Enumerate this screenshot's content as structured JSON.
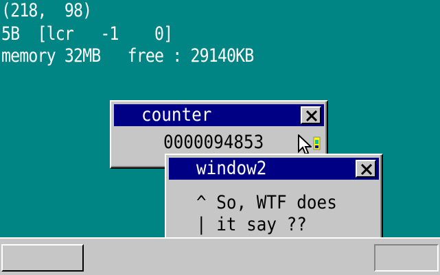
{
  "debug": {
    "mouse_coords": "(218,  98)",
    "mouse_state": "5B  [lcr   -1    0]",
    "memory": "memory 32MB   free : 29140KB"
  },
  "windows": {
    "counter": {
      "title": "counter",
      "value": "0000094853"
    },
    "window2": {
      "title": "window2",
      "lines": [
        "^ So, WTF does",
        "| it say ??"
      ]
    }
  },
  "colors": {
    "desktop": "#008484",
    "titlebar_active": "#000084",
    "window_face": "#c6c6c6"
  },
  "icons": [
    "close-icon",
    "mouse-cursor-icon",
    "app-icon"
  ]
}
